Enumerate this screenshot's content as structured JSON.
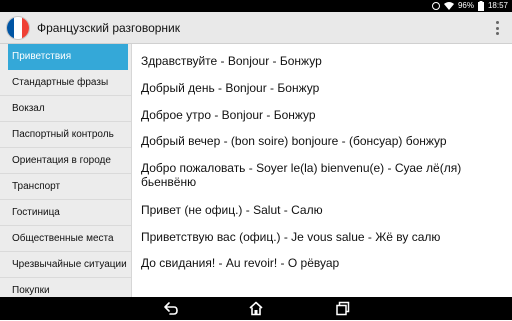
{
  "status": {
    "battery": "96%",
    "time": "18:57",
    "icons": [
      "alarm-icon",
      "wifi-icon",
      "battery-icon"
    ]
  },
  "app": {
    "title": "Французский разговорник",
    "logo": "french-flag-icon",
    "logo_colors": [
      "#0055a4",
      "#ffffff",
      "#ef4135"
    ],
    "menu_icon": "overflow-menu-icon"
  },
  "sidebar": {
    "accent": "#34a8d8",
    "items": [
      {
        "label": "Приветствия",
        "active": true
      },
      {
        "label": "Стандартные фразы"
      },
      {
        "label": "Вокзал"
      },
      {
        "label": "Паспортный контроль"
      },
      {
        "label": "Ориентация в городе"
      },
      {
        "label": "Транспорт"
      },
      {
        "label": "Гостиница"
      },
      {
        "label": "Общественные места"
      },
      {
        "label": "Чрезвычайные ситуации"
      },
      {
        "label": "Покупки"
      }
    ]
  },
  "phrases": [
    "Здравствуйте - Bonjour - Бонжур",
    "Добрый день - Bonjour - Бонжур",
    "Доброе утро - Bonjour - Бонжур",
    "Добрый вечер - (bon soire) bonjoure - (бонсуар) бонжур",
    "Добро пожаловать - Soyer le(la) bienvenu(e) - Суае лё(ля) бьенвёню",
    "Привет (не офиц.) - Salut - Салю",
    "Приветствую вас (офиц.) - Je vous salue - Жё ву салю",
    "До свидания! - Au revoir! - О рёвуар"
  ],
  "navbar": {
    "icons": [
      "back-icon",
      "home-icon",
      "recent-apps-icon"
    ]
  }
}
